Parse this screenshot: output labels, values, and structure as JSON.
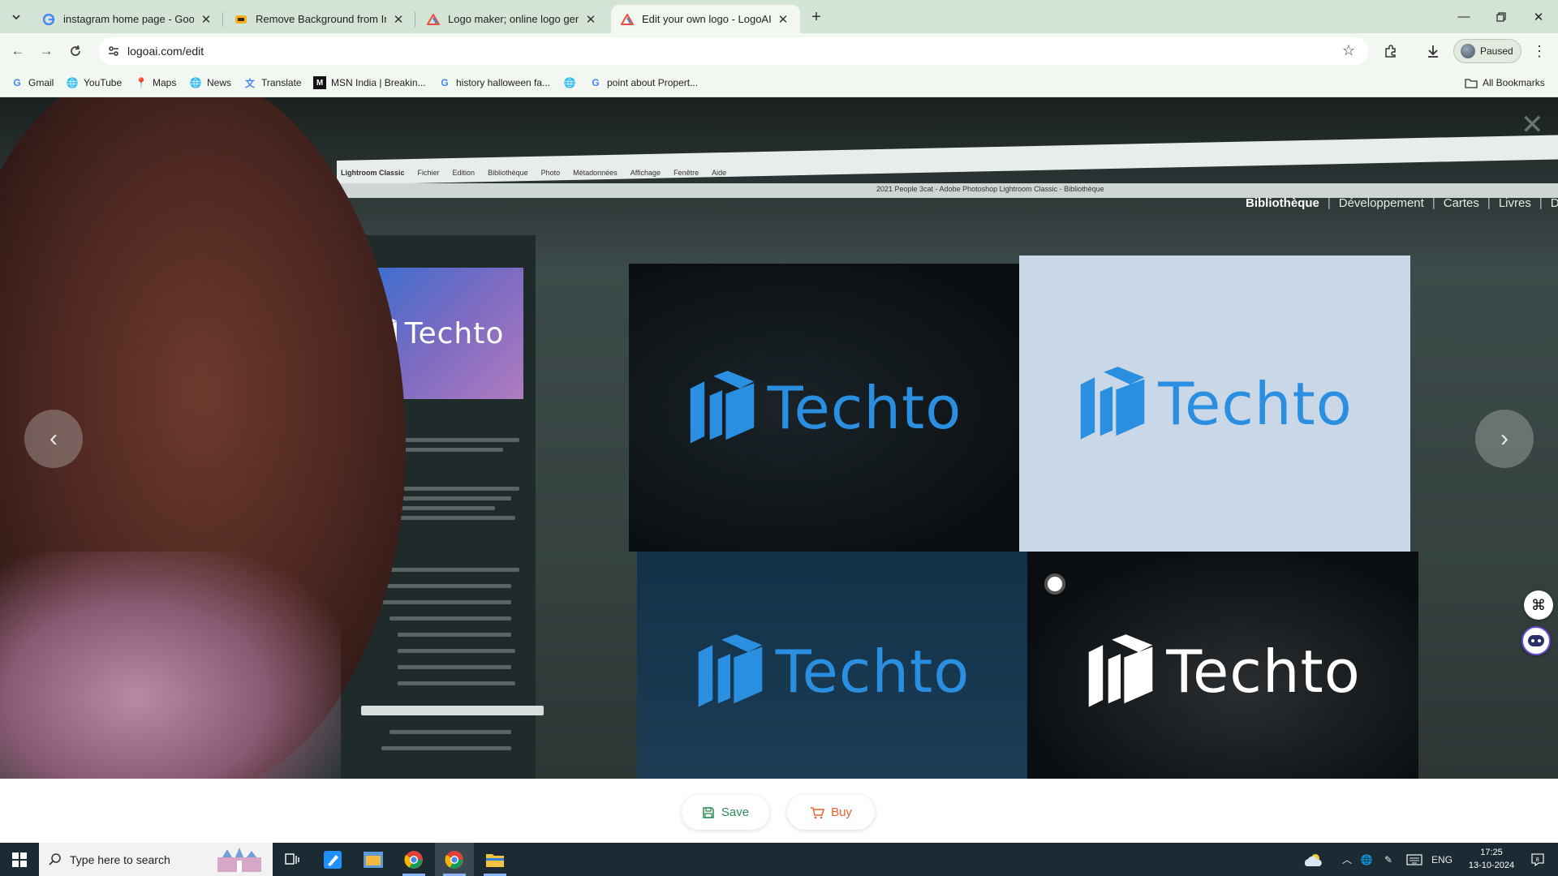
{
  "browser": {
    "tabs": [
      {
        "title": "instagram home page - Google",
        "favicon": "google-g-icon"
      },
      {
        "title": "Remove Background from Imag",
        "favicon": "removebg-icon"
      },
      {
        "title": "Logo maker; online logo genera",
        "favicon": "logoai-icon"
      },
      {
        "title": "Edit your own logo - LogoAI.co",
        "favicon": "logoai-icon",
        "active": true
      }
    ],
    "address": "logoai.com/edit",
    "profile_label": "Paused",
    "bookmarks": [
      {
        "label": "Gmail",
        "icon": "google-g-icon"
      },
      {
        "label": "YouTube",
        "icon": "globe-icon"
      },
      {
        "label": "Maps",
        "icon": "maps-pin-icon"
      },
      {
        "label": "News",
        "icon": "globe-icon"
      },
      {
        "label": "Translate",
        "icon": "translate-icon"
      },
      {
        "label": "MSN India | Breakin...",
        "icon": "msn-icon"
      },
      {
        "label": "history halloween fa...",
        "icon": "google-g-icon"
      },
      {
        "label": "",
        "icon": "globe-icon"
      },
      {
        "label": "point about Propert...",
        "icon": "google-g-icon"
      }
    ],
    "all_bookmarks": "All Bookmarks"
  },
  "mockup": {
    "app_menu": [
      "Lightroom Classic",
      "Fichier",
      "Edition",
      "Bibliothèque",
      "Photo",
      "Métadonnées",
      "Affichage",
      "Fenêtre",
      "Aide"
    ],
    "window_title": "2021 People 3cat - Adobe Photoshop Lightroom Classic - Bibliothèque",
    "modules": [
      "Bibliothèque",
      "Développement",
      "Cartes",
      "Livres",
      "Dia"
    ],
    "brand_name": "Techto",
    "colors": {
      "brand_blue": "#2a8fe0",
      "panel_dark": "#0c1114",
      "panel_light": "#c9d7e6",
      "panel_navy": "#123048",
      "panel_black": "#0a0e10"
    }
  },
  "actions": {
    "save_label": "Save",
    "buy_label": "Buy",
    "save_color": "#2e8b57",
    "buy_color": "#e8622c"
  },
  "taskbar": {
    "search_placeholder": "Type here to search",
    "language": "ENG",
    "time": "17:25",
    "date": "13-10-2024"
  }
}
